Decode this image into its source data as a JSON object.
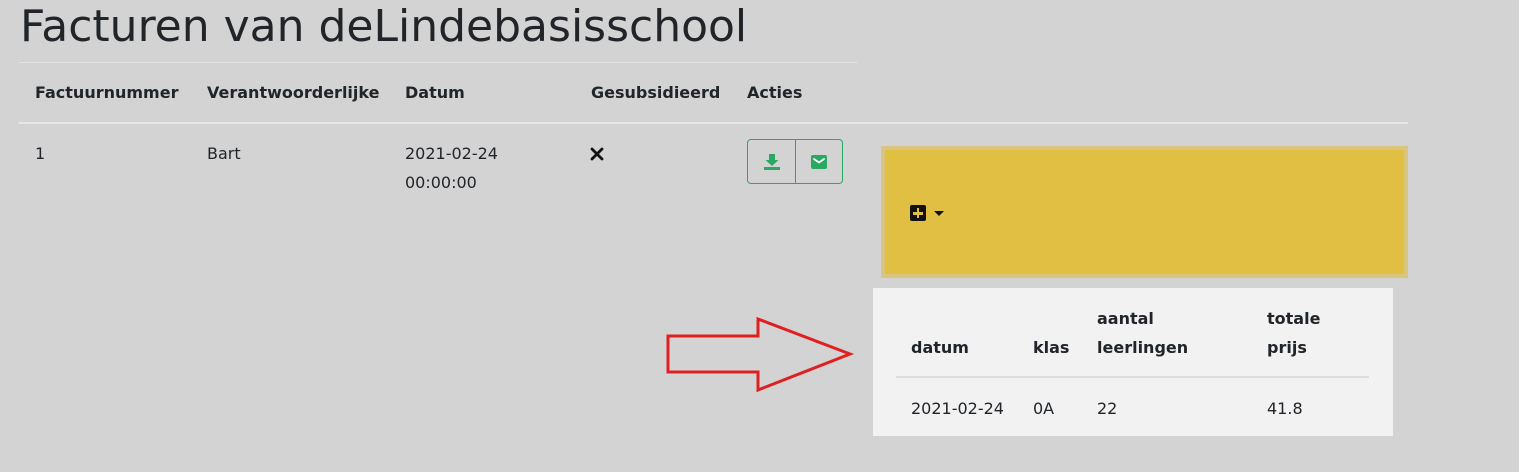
{
  "page": {
    "title": "Facturen van deLindebasisschool"
  },
  "invoices_table": {
    "headers": {
      "number": "Factuurnummer",
      "responsible": "Verantwoorderlijke",
      "date": "Datum",
      "subsidized": "Gesubsidieerd",
      "actions": "Acties"
    },
    "rows": [
      {
        "number": "1",
        "responsible": "Bart",
        "date": "2021-02-24 00:00:00",
        "subsidized": false
      }
    ]
  },
  "icons": {
    "subsidized_false": "times-icon",
    "download": "download-icon",
    "mail": "envelope-icon",
    "add": "plus-square-icon",
    "dropdown": "caret-down-icon",
    "annotation": "red-arrow-right"
  },
  "details_table": {
    "headers": {
      "date": "datum",
      "class": "klas",
      "students": "aantal leerlingen",
      "total": "totale prijs"
    },
    "rows": [
      {
        "date": "2021-02-24",
        "class": "0A",
        "students": "22",
        "total": "41.8"
      }
    ]
  },
  "colors": {
    "background": "#d3d3d3",
    "accent_green": "#2aa861",
    "panel_yellow": "#e0bf43",
    "annotation_red": "#e02020",
    "details_background": "#f2f2f2"
  }
}
